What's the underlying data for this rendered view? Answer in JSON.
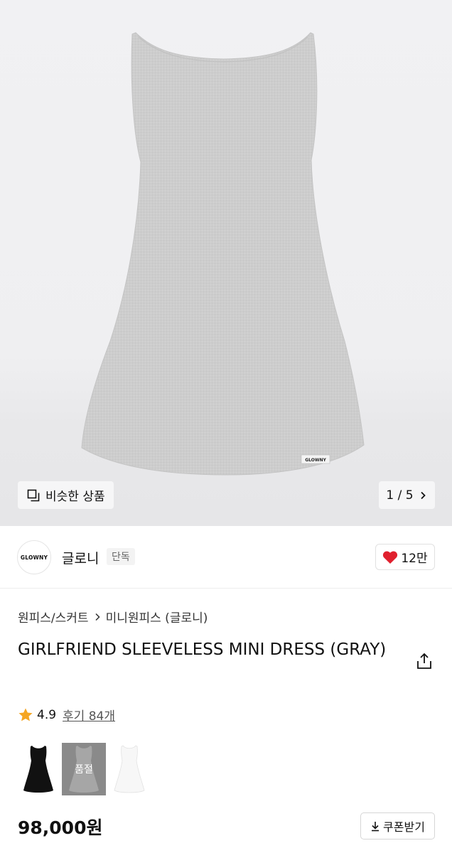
{
  "gallery": {
    "product_image_label_text": "GLOWNY",
    "similar_label": "비슷한 상품",
    "pager": "1 / 5"
  },
  "brand": {
    "logo_text": "GLOWNY",
    "name": "글로니",
    "badge": "단독",
    "like_count": "12만"
  },
  "product": {
    "breadcrumb": [
      "원피스/스커트",
      "미니원피스 (글로니)"
    ],
    "title": "GIRLFRIEND SLEEVELESS MINI DRESS (GRAY)",
    "rating": "4.9",
    "reviews": "후기 84개",
    "color_options": [
      {
        "color": "black",
        "swatch": "#111111",
        "sold_out": false
      },
      {
        "color": "gray",
        "swatch": "#8a8a8a",
        "sold_out": true,
        "badge": "품절"
      },
      {
        "color": "white",
        "swatch": "#f7f7f7",
        "sold_out": false
      }
    ],
    "price": "98,000원",
    "coupon_label": "쿠폰받기"
  },
  "colors": {
    "heart": "#e0202e",
    "star": "#f5a623",
    "dress_gray": "#cfcfcf"
  },
  "icons": {
    "similar": "similar-products-icon",
    "pager_next": "chevron-right-icon",
    "like": "heart-icon",
    "breadcrumb_separator": "chevron-right-icon",
    "share": "share-icon",
    "rating": "star-icon",
    "coupon": "download-icon"
  }
}
